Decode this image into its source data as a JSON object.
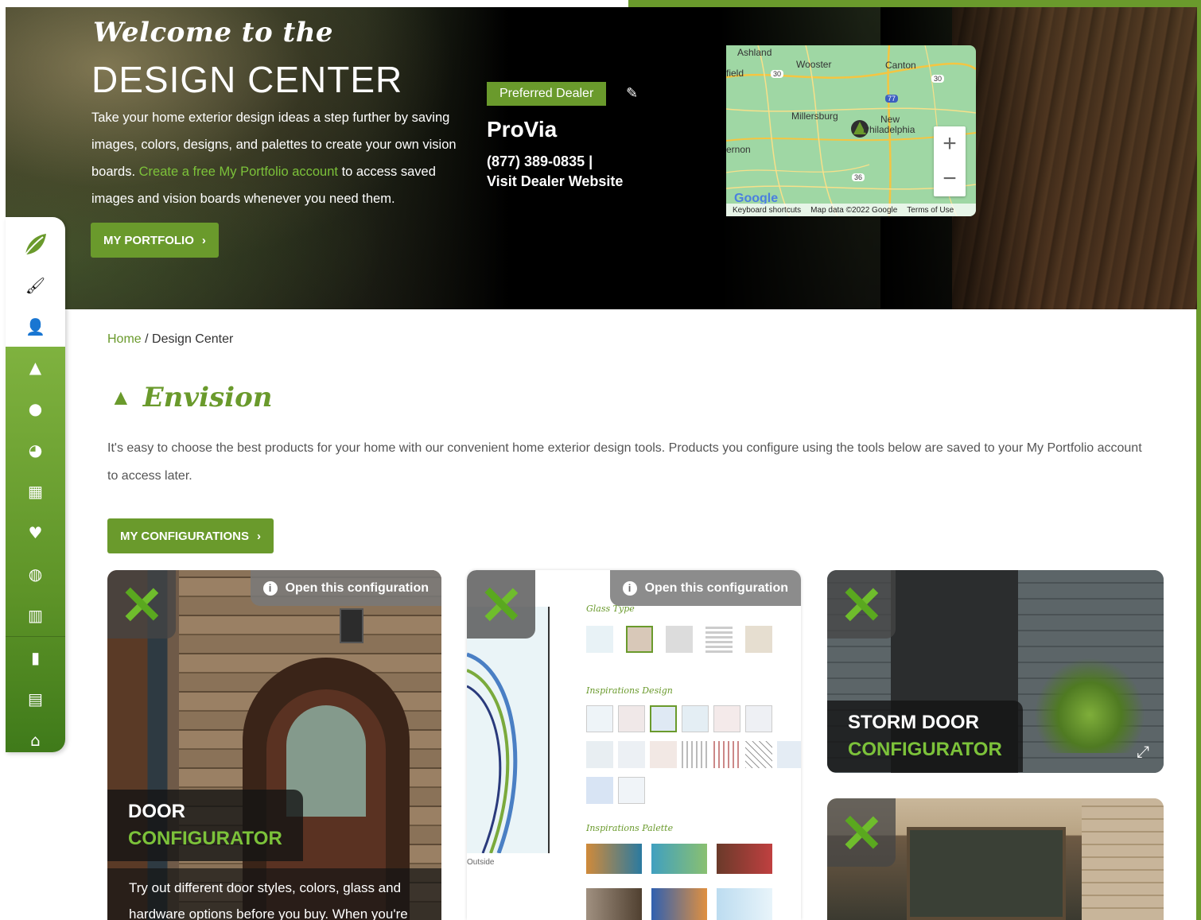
{
  "hero": {
    "script_title": "Welcome to the",
    "title": "DESIGN CENTER",
    "desc_pre": "Take your home exterior design ideas a step further by saving images, colors, designs, and palettes to create your own vision boards. ",
    "desc_link": "Create a free My Portfolio account",
    "desc_post": " to access saved images and vision boards whenever you need them.",
    "portfolio_button": "MY PORTFOLIO",
    "portfolio_chevron": "›"
  },
  "dealer": {
    "badge": "Preferred Dealer",
    "name": "ProVia",
    "phone": "(877) 389-0835 |",
    "website": "Visit Dealer Website"
  },
  "map": {
    "places": [
      "Ashland",
      "Wooster",
      "Canton",
      "field",
      "Millersburg",
      "New",
      "Philadelphia",
      "ernon"
    ],
    "route_30_a": "30",
    "route_30_b": "30",
    "route_77": "77",
    "route_36": "36",
    "zoom_in": "+",
    "zoom_out": "−",
    "footer_shortcuts": "Keyboard shortcuts",
    "footer_data": "Map data ©2022 Google",
    "footer_terms": "Terms of Use",
    "google": "Google"
  },
  "sidebar": {
    "top_icons": [
      "leaf-icon",
      "brush-icon",
      "user-icon"
    ],
    "bottom_icons": [
      "tree-icon",
      "lightbulb-icon",
      "palette-icon",
      "grid-icon",
      "heart-icon",
      "globe-icon",
      "columns-icon",
      "door-icon",
      "clipboard-icon",
      "home-icon"
    ]
  },
  "breadcrumb": {
    "home": "Home",
    "sep": " / ",
    "current": "Design Center"
  },
  "envision": {
    "title": "Envision",
    "intro": "It's easy to choose the best products for your home with our convenient home exterior design tools. Products you configure using the tools below are saved to your My Portfolio account to access later.",
    "configs_button": "MY CONFIGURATIONS",
    "configs_chevron": "›"
  },
  "cards": {
    "open_label": "Open this configuration",
    "door": {
      "line1": "DOOR",
      "line2": "CONFIGURATOR",
      "desc": "Try out different door styles, colors, glass and hardware options before you buy. When you're"
    },
    "glass": {
      "glass_type": "Glass Type",
      "inspiration_design": "Inspirations Design",
      "inspiration_palette": "Inspirations Palette",
      "outside": "Outside"
    },
    "storm": {
      "line1": "STORM DOOR",
      "line2": "CONFIGURATOR"
    }
  },
  "colors": {
    "brand_green": "#6a9a2c",
    "link_green": "#7cc23a"
  }
}
